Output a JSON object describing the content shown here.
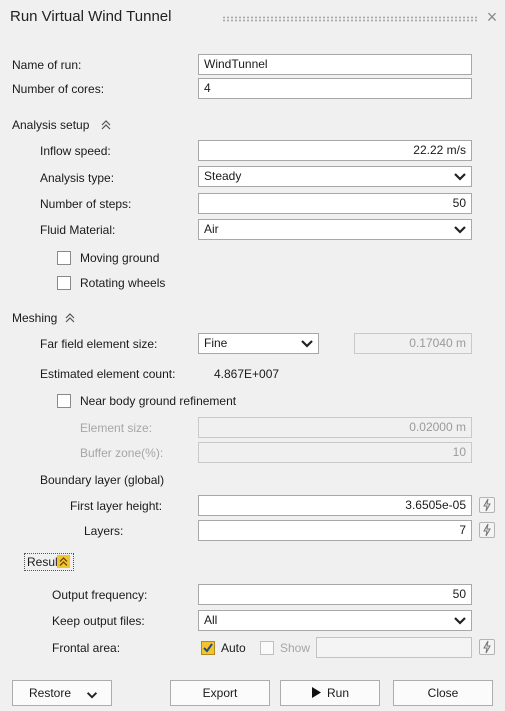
{
  "window": {
    "title": "Run Virtual Wind Tunnel",
    "close_glyph": "×"
  },
  "general": {
    "run_name_label": "Name of run:",
    "run_name_value": "WindTunnel",
    "cores_label": "Number of cores:",
    "cores_value": "4"
  },
  "analysis": {
    "section_label": "Analysis setup",
    "inflow_label": "Inflow speed:",
    "inflow_value": "22.22 m/s",
    "type_label": "Analysis type:",
    "type_value": "Steady",
    "steps_label": "Number of steps:",
    "steps_value": "50",
    "fluid_label": "Fluid Material:",
    "fluid_value": "Air",
    "moving_ground_label": "Moving ground",
    "moving_ground_checked": false,
    "rotating_wheels_label": "Rotating wheels",
    "rotating_wheels_checked": false
  },
  "meshing": {
    "section_label": "Meshing",
    "far_field_label": "Far field element size:",
    "far_field_value": "Fine",
    "far_field_size": "0.17040 m",
    "estimated_count_label": "Estimated element count:",
    "estimated_count_value": "4.867E+007",
    "near_body_label": "Near body ground refinement",
    "near_body_checked": false,
    "element_size_label": "Element size:",
    "element_size_value": "0.02000 m",
    "buffer_zone_label": "Buffer zone(%):",
    "buffer_zone_value": "10",
    "boundary_layer_label": "Boundary layer (global)",
    "first_layer_label": "First layer height:",
    "first_layer_value": "3.6505e-05",
    "layers_label": "Layers:",
    "layers_value": "7"
  },
  "results": {
    "section_label": "Results",
    "output_freq_label": "Output frequency:",
    "output_freq_value": "50",
    "keep_files_label": "Keep output files:",
    "keep_files_value": "All",
    "frontal_area_label": "Frontal area:",
    "auto_label": "Auto",
    "auto_checked": true,
    "show_label": "Show",
    "show_checked": false,
    "frontal_area_value": ""
  },
  "footer": {
    "restore_label": "Restore",
    "export_label": "Export",
    "run_label": "Run",
    "close_label": "Close"
  },
  "colors": {
    "accent": "#f4c430",
    "background": "#f0f0f0",
    "field_border": "#a8a8a8"
  },
  "icons": [
    "close-icon",
    "collapse-up-icon",
    "dropdown-arrow-icon",
    "checkbox-icon",
    "lightning-icon",
    "play-icon"
  ]
}
